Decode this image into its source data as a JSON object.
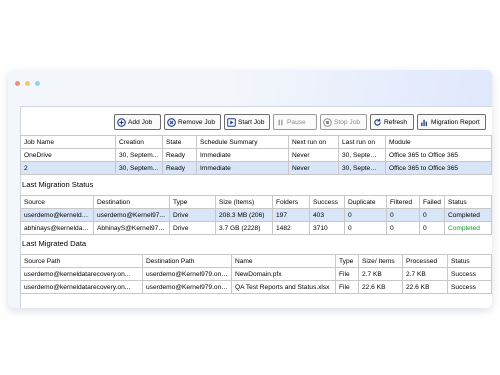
{
  "window_dots": [
    "#f28b82",
    "#f7c56b",
    "#8fd3f4"
  ],
  "toolbar": [
    {
      "label": "Add Job",
      "icon": "add-icon",
      "enabled": true
    },
    {
      "label": "Remove Job",
      "icon": "remove-icon",
      "enabled": true
    },
    {
      "label": "Start Job",
      "icon": "play-icon",
      "enabled": true
    },
    {
      "label": "Pause",
      "icon": "pause-icon",
      "enabled": false
    },
    {
      "label": "Stop Job",
      "icon": "stop-icon",
      "enabled": false
    },
    {
      "label": "Refresh",
      "icon": "refresh-icon",
      "enabled": true
    },
    {
      "label": "Migration Report",
      "icon": "report-icon",
      "enabled": true
    }
  ],
  "jobs": {
    "columns": [
      "Job Name",
      "Creation",
      "State",
      "Schedule Summary",
      "Next run on",
      "Last run on",
      "Module"
    ],
    "rows": [
      [
        "OneDrive",
        "30, Septem...",
        "Ready",
        "Immediate",
        "Never",
        "30, Septemb...",
        "Office 365 to Office 365"
      ],
      [
        "2",
        "30, Septem...",
        "Ready",
        "Immediate",
        "Never",
        "30, Septemb...",
        "Office 365 to Office 365"
      ]
    ]
  },
  "last_migration_status": {
    "title": "Last Migration Status",
    "columns": [
      "Source",
      "Destination",
      "Type",
      "Size (Items)",
      "Folders",
      "Success",
      "Duplicate",
      "Filtered",
      "Failed",
      "Status"
    ],
    "rows": [
      [
        "userdemo@kerneldat...",
        "userdemo@Kernel97...",
        "Drive",
        "208.3 MB (206)",
        "197",
        "403",
        "0",
        "0",
        "0",
        "Completed"
      ],
      [
        "abhinays@kerneldata...",
        "AbhinayS@Kernel979...",
        "Drive",
        "3.7 GB (2228)",
        "1482",
        "3710",
        "0",
        "0",
        "0",
        "Completed"
      ]
    ],
    "status_colors": [
      "#000000",
      "#139c2c"
    ]
  },
  "last_migrated_data": {
    "title": "Last Migrated Data",
    "columns": [
      "Source Path",
      "Destination Path",
      "Name",
      "Type",
      "Size/ Items",
      "Processed",
      "Status"
    ],
    "rows": [
      [
        "userdemo@kerneldatarecovery.on...",
        "userdemo@Kernel979.onr...",
        "NewDomain.pfx",
        "File",
        "2.7 KB",
        "2.7 KB",
        "Success"
      ],
      [
        "userdemo@kerneldatarecovery.on...",
        "userdemo@Kernel979.onr...",
        "QA Test Reports and Status.xlsx",
        "File",
        "22.6 KB",
        "22.6 KB",
        "Success"
      ]
    ]
  }
}
